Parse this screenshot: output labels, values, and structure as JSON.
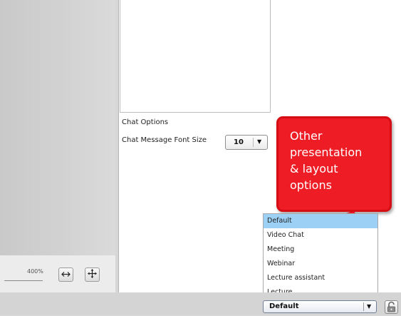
{
  "zoom": {
    "label": "400%"
  },
  "toolbar": {
    "fit_width_icon": "fit-width-icon",
    "pan_icon": "move-icon"
  },
  "chat_options": {
    "title": "Chat Options",
    "font_size_label": "Chat Message Font Size",
    "font_size_value": "10"
  },
  "callout": {
    "text": "Other presentation & layout options",
    "color": "#ee1c25"
  },
  "layout_menu": {
    "items": [
      {
        "label": "Default",
        "selected": true
      },
      {
        "label": "Video Chat",
        "selected": false
      },
      {
        "label": "Meeting",
        "selected": false
      },
      {
        "label": "Webinar",
        "selected": false
      },
      {
        "label": "Lecture assistant",
        "selected": false
      },
      {
        "label": "Lecture",
        "selected": false
      }
    ],
    "selected_value": "Default",
    "highlight_color": "#9cd0f5"
  },
  "lock_icon": "unlocked-padlock-icon"
}
